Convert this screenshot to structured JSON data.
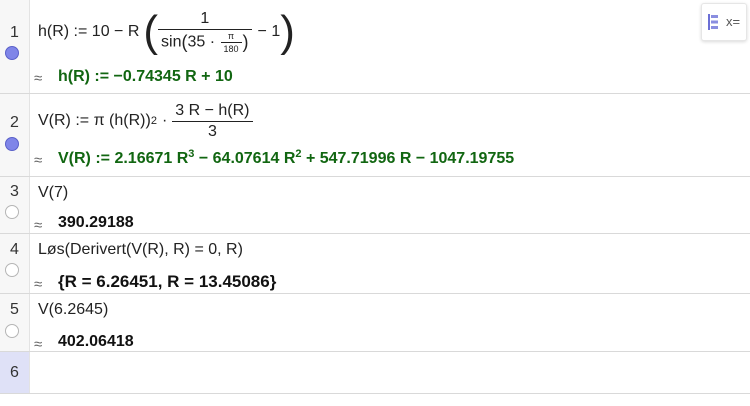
{
  "rows": [
    {
      "number": "1",
      "input": {
        "lhs": "h(R) := 10 − R",
        "frac_num": "1",
        "frac_den_prefix": "sin",
        "frac_den_arg": "35 ·",
        "pi_num": "π",
        "pi_den": "180",
        "minus_one": "− 1"
      },
      "approx_symbol": "≈",
      "output": "h(R) := −0.74345 R + 10",
      "marker": "on"
    },
    {
      "number": "2",
      "input": {
        "lhs": "V(R) := π (h(R))",
        "exp": "2",
        "dot": "·",
        "frac_num": "3 R − h(R)",
        "frac_den": "3"
      },
      "approx_symbol": "≈",
      "output": {
        "p1": "V(R) := 2.16671 R",
        "e1": "3",
        "p2": " − 64.07614 R",
        "e2": "2",
        "p3": " + 547.71996 R − 1047.19755"
      },
      "marker": "on"
    },
    {
      "number": "3",
      "input": "V(7)",
      "approx_symbol": "≈",
      "output": "390.29188",
      "marker": "off"
    },
    {
      "number": "4",
      "input": "Løs(Derivert(V(R), R) = 0, R)",
      "approx_symbol": "≈",
      "output": "{R = 6.26451, R = 13.45086}",
      "marker": "off"
    },
    {
      "number": "5",
      "input": "V(6.2645)",
      "approx_symbol": "≈",
      "output": "402.06418",
      "marker": "off"
    },
    {
      "number": "6"
    }
  ],
  "toolbar": {
    "icon": "algebra-input-icon",
    "label": "x="
  },
  "colors": {
    "output_green": "#116611",
    "marker_on": "#7f85e8",
    "active_row": "#dfe1f7"
  }
}
